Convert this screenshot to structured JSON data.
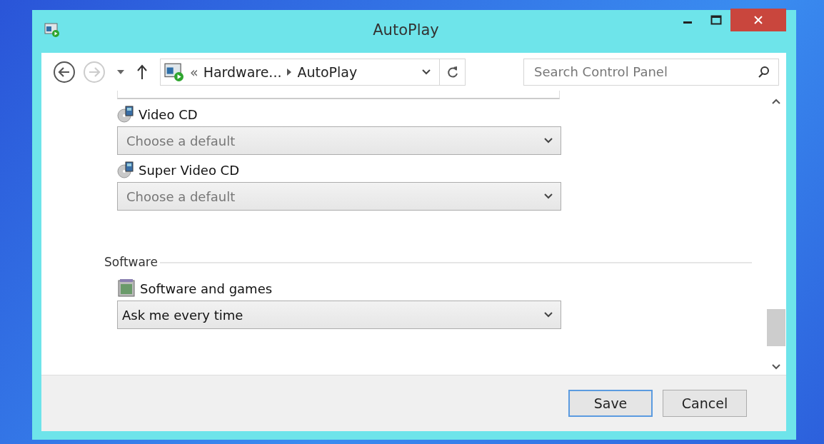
{
  "window": {
    "title": "AutoPlay"
  },
  "nav": {
    "back_disabled": false,
    "forward_disabled": true
  },
  "address": {
    "overflow": "«",
    "crumbs": [
      "Hardware...",
      "AutoPlay"
    ]
  },
  "search": {
    "placeholder": "Search Control Panel"
  },
  "sections": [
    {
      "items": [
        {
          "kind": "disc",
          "label": "Video CD",
          "placeholder": "Choose a default"
        },
        {
          "kind": "disc",
          "label": "Super Video CD",
          "placeholder": "Choose a default"
        }
      ]
    },
    {
      "heading": "Software",
      "items": [
        {
          "kind": "software",
          "label": "Software and games",
          "value": "Ask me every time"
        }
      ]
    }
  ],
  "buttons": [
    {
      "label": "Save",
      "default": true
    },
    {
      "label": "Cancel",
      "default": false
    }
  ]
}
